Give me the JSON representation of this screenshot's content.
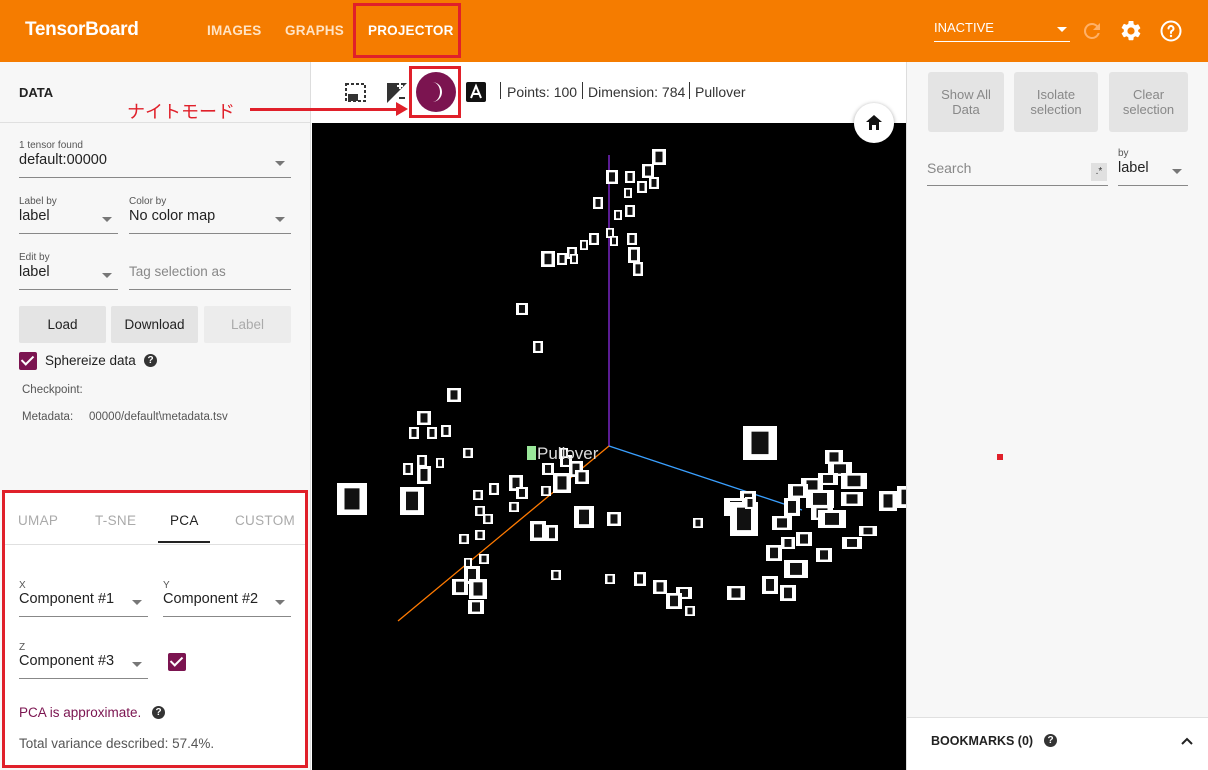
{
  "header": {
    "brand": "TensorBoard",
    "tabs": [
      {
        "label": "IMAGES"
      },
      {
        "label": "GRAPHS"
      },
      {
        "label": "PROJECTOR"
      }
    ],
    "run_select": "INACTIVE",
    "icons": [
      "refresh-icon",
      "settings-icon",
      "help-icon"
    ]
  },
  "data_panel": {
    "title": "DATA",
    "tensor_count": "1 tensor found",
    "tensor_select": "default:00000",
    "label_by": {
      "label": "Label by",
      "value": "label"
    },
    "color_by": {
      "label": "Color by",
      "value": "No color map"
    },
    "edit_by": {
      "label": "Edit by",
      "value": "label"
    },
    "tag_placeholder": "Tag selection as",
    "buttons": {
      "load": "Load",
      "download": "Download",
      "label": "Label"
    },
    "sphereize": "Sphereize data",
    "checkpoint_label": "Checkpoint:",
    "metadata_label": "Metadata:",
    "metadata_value": "00000/default\\metadata.tsv"
  },
  "projection_panel": {
    "tabs": [
      {
        "label": "UMAP"
      },
      {
        "label": "T-SNE"
      },
      {
        "label": "PCA"
      },
      {
        "label": "CUSTOM"
      }
    ],
    "active_tab": "PCA",
    "x": {
      "label": "X",
      "value": "Component #1"
    },
    "y": {
      "label": "Y",
      "value": "Component #2"
    },
    "z": {
      "label": "Z",
      "value": "Component #3"
    },
    "approx_note": "PCA is approximate.",
    "variance": "Total variance described: 57.4%."
  },
  "toolbar": {
    "points": "Points: 100",
    "dimension": "Dimension: 784",
    "selected_label": "Pullover"
  },
  "annotation": {
    "night_mode_label": "ナイトモード"
  },
  "canvas": {
    "hover_label": "Pullover"
  },
  "inspector": {
    "show_all": [
      "Show All",
      "Data"
    ],
    "isolate": [
      "Isolate",
      "selection"
    ],
    "clear": [
      "Clear",
      "selection"
    ],
    "search_placeholder": "Search",
    "regex": ".*",
    "by_label": "by",
    "by_value": "label",
    "bookmarks": "BOOKMARKS (0)"
  },
  "colors": {
    "header": "#f57c00",
    "accent": "#7b1450",
    "highlight": "#e0202a"
  }
}
